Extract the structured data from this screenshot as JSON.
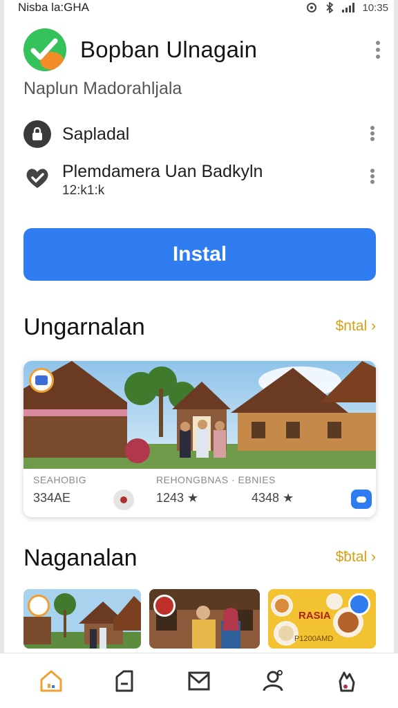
{
  "status_bar": {
    "left_text": "Nisba la:GHA",
    "time": "10:35"
  },
  "app": {
    "title": "Bopban Ulnagain",
    "developer": "Naplun Madorahljala"
  },
  "info_rows": [
    {
      "icon": "lock-icon",
      "label": "Sapladal"
    },
    {
      "icon": "heart-check-icon",
      "label": "Plemdamera Uan Badkyln",
      "sub": "12:k1:k"
    }
  ],
  "install_button": {
    "label": "Instal"
  },
  "sections": [
    {
      "title": "Ungarnalan",
      "link": "$ntal ›"
    },
    {
      "title": "Naganalan",
      "link": "$ƀtal ›"
    }
  ],
  "feature_card": {
    "label_left": "SEAHOBIG",
    "label_right": "REHONGBNAS · EBNIES",
    "stat_1": "334AE",
    "stat_2": "1243 ★",
    "stat_3": "4348 ★"
  },
  "thumbnails": {
    "promo_text": "RASIA",
    "promo_sub": "P1200AMD"
  },
  "bottom_nav": [
    {
      "icon": "home-icon"
    },
    {
      "icon": "bag-icon"
    },
    {
      "icon": "mail-icon"
    },
    {
      "icon": "person-icon"
    },
    {
      "icon": "hand-icon"
    }
  ],
  "colors": {
    "accent": "#2f7bf0",
    "link": "#d4a017",
    "logo_green": "#35c25a",
    "logo_orange": "#f28c28"
  }
}
